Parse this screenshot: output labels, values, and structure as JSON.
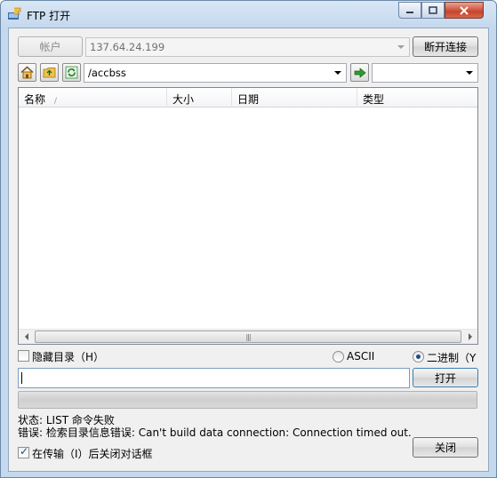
{
  "window": {
    "title": "FTP 打开",
    "icon": "ftp-app-icon",
    "controls": [
      "minimize-icon",
      "maximize-icon",
      "close-icon"
    ]
  },
  "connection": {
    "account_label": "帐户",
    "host": "137.64.24.199",
    "disconnect_label": "断开连接"
  },
  "toolbar": {
    "icons": [
      "home-icon",
      "up-folder-icon",
      "refresh-icon"
    ],
    "path": "/accbss",
    "go_icon": "go-arrow-icon",
    "filter_value": ""
  },
  "file_list": {
    "columns": [
      {
        "label": "名称",
        "sort_glyph": "/"
      },
      {
        "label": "大小"
      },
      {
        "label": "日期"
      },
      {
        "label": "类型"
      }
    ],
    "rows": []
  },
  "options": {
    "hide_dirs_label": "隐藏目录（H）",
    "hide_dirs_checked": false,
    "ascii_label": "ASCII",
    "binary_label": "二进制（Y",
    "transfer_mode": "binary"
  },
  "filename": {
    "value": "",
    "open_label": "打开"
  },
  "progress": {
    "value": 0
  },
  "status": {
    "status_line": "状态: LIST 命令失败",
    "error_line": "错误: 检索目录信息错误: Can't build data connection: Connection timed out."
  },
  "footer": {
    "close_after_label": "在传输（I）后关闭对话框",
    "close_after_checked": true,
    "close_label": "关闭"
  }
}
